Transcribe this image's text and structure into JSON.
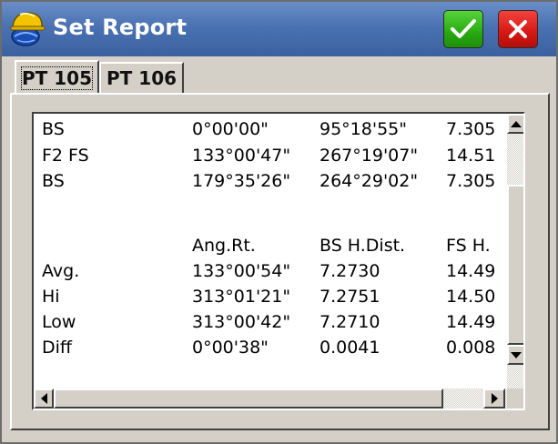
{
  "window": {
    "title": "Set Report",
    "app_icon": "hardhat-globe-icon",
    "ok_icon": "checkmark-icon",
    "close_icon": "close-x-icon",
    "colors": {
      "titlebar": "#4a72b2",
      "ok": "#28a912",
      "close": "#d51813",
      "face": "#d4d0c8"
    }
  },
  "tabs": [
    {
      "label": "PT 105",
      "active": true
    },
    {
      "label": "PT 106",
      "active": false
    }
  ],
  "report": {
    "rows": [
      [
        "BS",
        "0°00'00\"",
        "95°18'55\"",
        "7.305"
      ],
      [
        "F2 FS",
        "133°00'47\"",
        "267°19'07\"",
        "14.51"
      ],
      [
        "BS",
        "179°35'26\"",
        "264°29'02\"",
        "7.305"
      ],
      [
        "",
        "",
        "",
        ""
      ],
      [
        "",
        "Ang.Rt.",
        "BS H.Dist.",
        "FS H."
      ],
      [
        "Avg.",
        "133°00'54\"",
        "7.2730",
        "14.49"
      ],
      [
        "Hi",
        "313°01'21\"",
        "7.2751",
        "14.50"
      ],
      [
        "Low",
        "313°00'42\"",
        "7.2710",
        "14.49"
      ],
      [
        "Diff",
        "0°00'38\"",
        "0.0041",
        "0.008"
      ]
    ]
  },
  "scrollbars": {
    "up_icon": "arrow-up-icon",
    "down_icon": "arrow-down-icon",
    "left_icon": "arrow-left-icon",
    "right_icon": "arrow-right-icon"
  }
}
